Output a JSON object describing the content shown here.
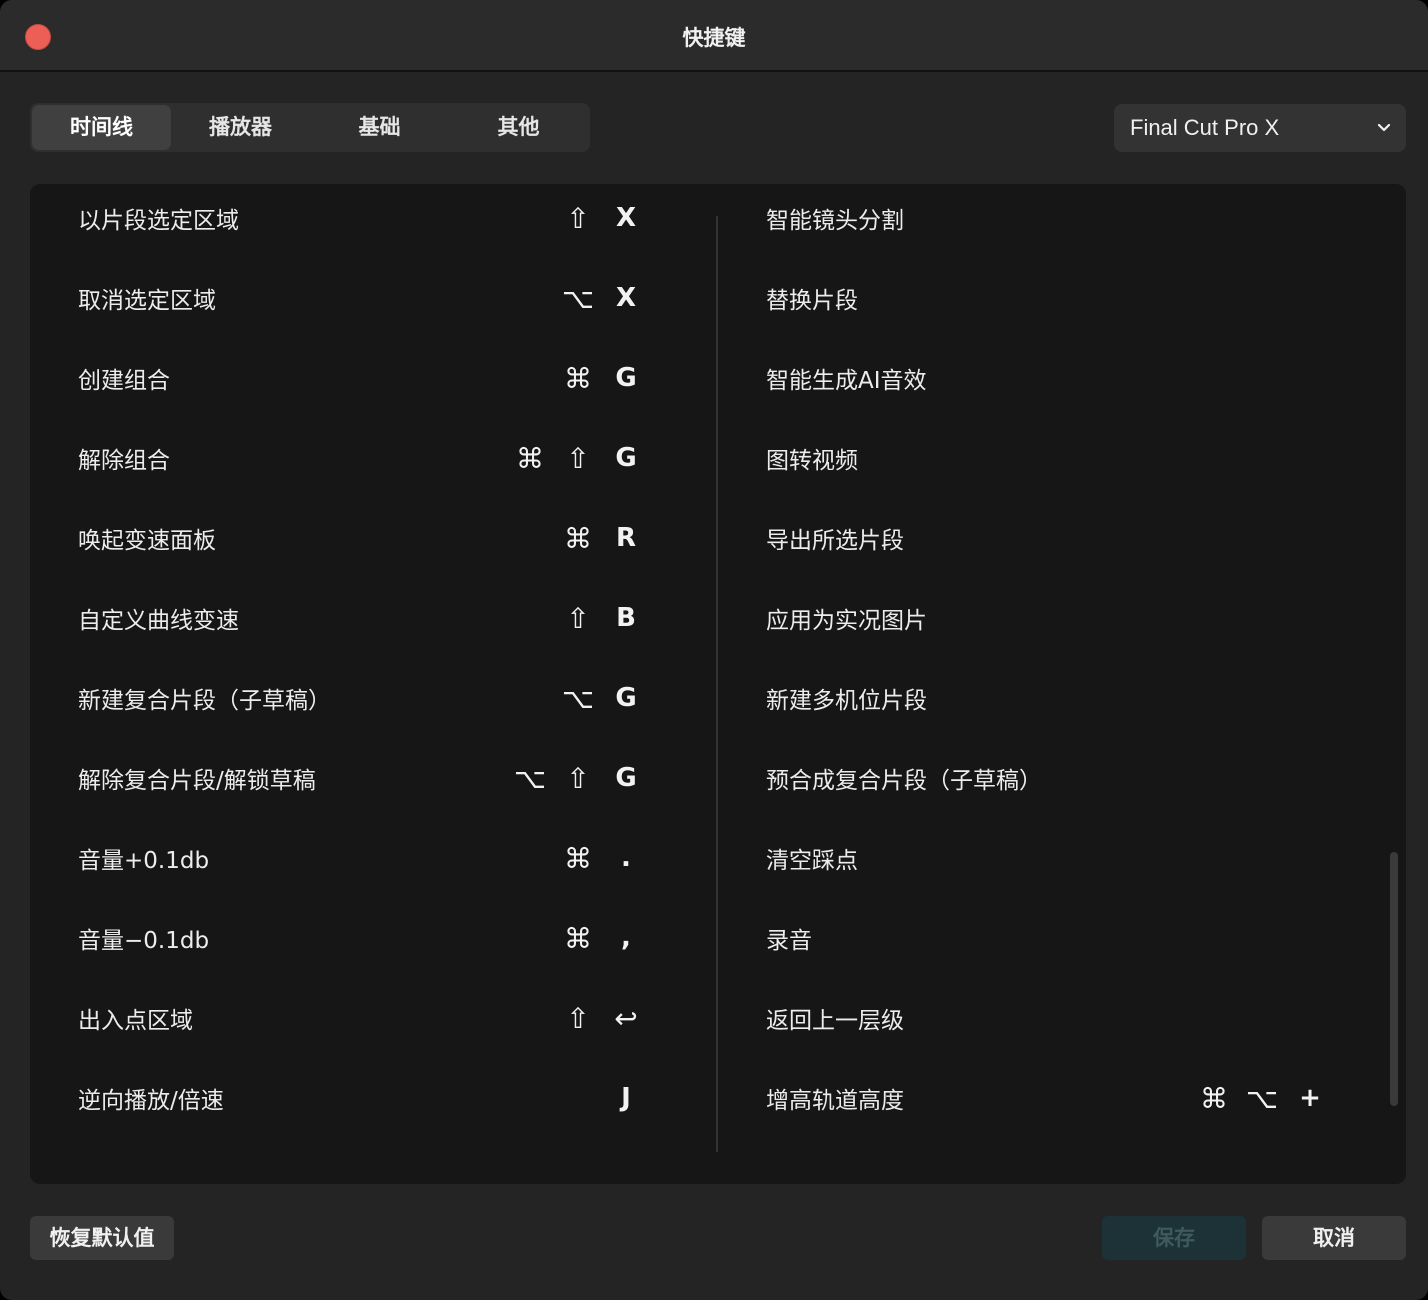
{
  "window": {
    "title": "快捷键"
  },
  "tabs": [
    {
      "label": "时间线",
      "active": true
    },
    {
      "label": "播放器",
      "active": false
    },
    {
      "label": "基础",
      "active": false
    },
    {
      "label": "其他",
      "active": false
    }
  ],
  "preset": {
    "value": "Final Cut Pro X"
  },
  "left_rows": [
    {
      "label": "以片段选定区域",
      "keys": [
        "⇧",
        "X"
      ]
    },
    {
      "label": "取消选定区域",
      "keys": [
        "⌥",
        "X"
      ]
    },
    {
      "label": "创建组合",
      "keys": [
        "⌘",
        "G"
      ]
    },
    {
      "label": "解除组合",
      "keys": [
        "⌘",
        "⇧",
        "G"
      ]
    },
    {
      "label": "唤起变速面板",
      "keys": [
        "⌘",
        "R"
      ]
    },
    {
      "label": "自定义曲线变速",
      "keys": [
        "⇧",
        "B"
      ]
    },
    {
      "label": "新建复合片段（子草稿）",
      "keys": [
        "⌥",
        "G"
      ]
    },
    {
      "label": "解除复合片段/解锁草稿",
      "keys": [
        "⌥",
        "⇧",
        "G"
      ]
    },
    {
      "label": "音量+0.1db",
      "keys": [
        "⌘",
        "."
      ]
    },
    {
      "label": "音量−0.1db",
      "keys": [
        "⌘",
        ","
      ]
    },
    {
      "label": "出入点区域",
      "keys": [
        "⇧",
        "↩"
      ]
    },
    {
      "label": "逆向播放/倍速",
      "keys": [
        "J"
      ]
    }
  ],
  "right_rows": [
    {
      "label": "智能镜头分割",
      "keys": []
    },
    {
      "label": "替换片段",
      "keys": []
    },
    {
      "label": "智能生成AI音效",
      "keys": []
    },
    {
      "label": "图转视频",
      "keys": []
    },
    {
      "label": "导出所选片段",
      "keys": []
    },
    {
      "label": "应用为实况图片",
      "keys": []
    },
    {
      "label": "新建多机位片段",
      "keys": []
    },
    {
      "label": "预合成复合片段（子草稿）",
      "keys": []
    },
    {
      "label": "清空踩点",
      "keys": []
    },
    {
      "label": "录音",
      "keys": []
    },
    {
      "label": "返回上一层级",
      "keys": []
    },
    {
      "label": "增高轨道高度",
      "keys": [
        "⌘",
        "⌥",
        "+"
      ]
    }
  ],
  "footer": {
    "reset_label": "恢复默认值",
    "save_label": "保存",
    "cancel_label": "取消"
  },
  "colors": {
    "close": "#ec5f57",
    "save_bg": "#1d3236",
    "save_text": "#3e5a5c"
  }
}
